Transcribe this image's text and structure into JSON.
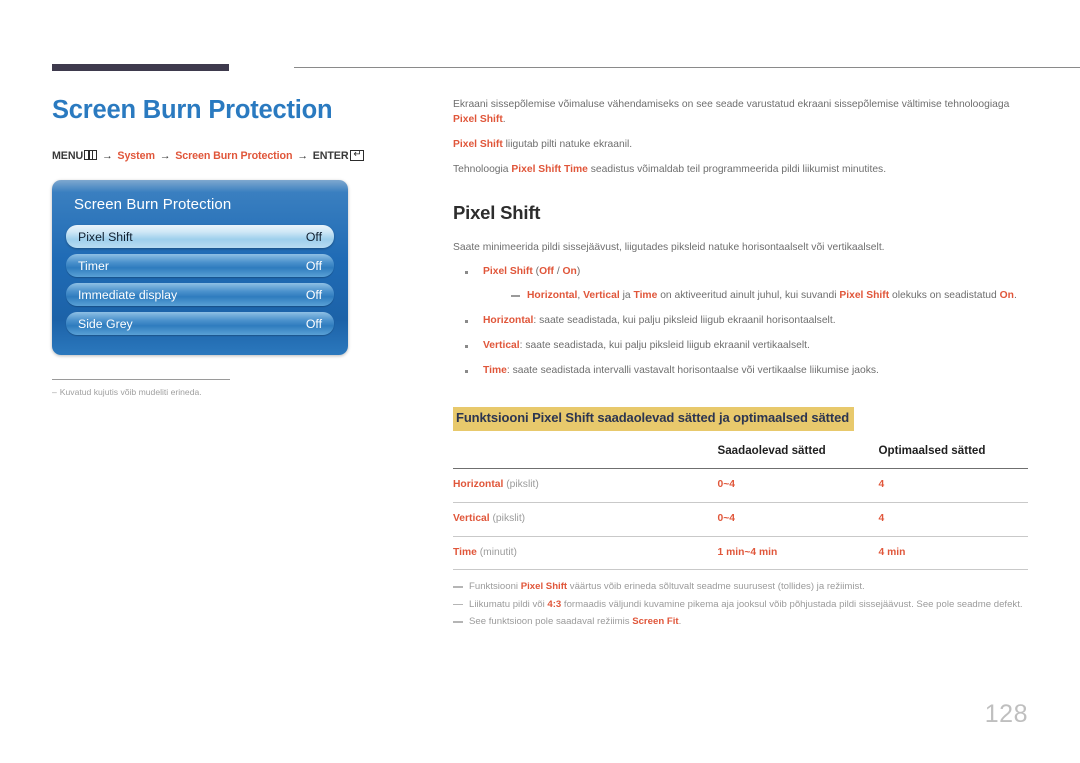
{
  "page_title": "Screen Burn Protection",
  "breadcrumb": {
    "menu_label": "MENU",
    "arrow": "→",
    "item1": "System",
    "item2": "Screen Burn Protection",
    "enter_label": "ENTER",
    "enter_glyph": "↵"
  },
  "osd": {
    "title": "Screen Burn Protection",
    "rows": [
      {
        "label": "Pixel Shift",
        "value": "Off",
        "selected": true
      },
      {
        "label": "Timer",
        "value": "Off",
        "selected": false
      },
      {
        "label": "Immediate display",
        "value": "Off",
        "selected": false
      },
      {
        "label": "Side Grey",
        "value": "Off",
        "selected": false
      }
    ]
  },
  "left_note": "Kuvatud kujutis võib mudeliti erineda.",
  "intro": {
    "p1_a": "Ekraani sissepõlemise võimaluse vähendamiseks on see seade varustatud ekraani sissepõlemise vältimise tehnoloogiaga ",
    "p1_accent": "Pixel Shift",
    "p1_b": ".",
    "p2_accent": "Pixel Shift",
    "p2_b": " liigutab pilti natuke ekraanil.",
    "p3_a": "Tehnoloogia ",
    "p3_accent": "Pixel Shift Time",
    "p3_b": " seadistus võimaldab teil programmeerida pildi liikumist minutites."
  },
  "section": {
    "title": "Pixel Shift",
    "lead": "Saate minimeerida pildi sissejäävust, liigutades piksleid natuke horisontaalselt või vertikaalselt."
  },
  "bullets": {
    "b1_accent": "Pixel Shift",
    "b1_text": " (",
    "b1_off": "Off",
    "b1_sep": " / ",
    "b1_on": "On",
    "b1_end": ")",
    "subnote_a1": "Horizontal",
    "subnote_t1": ", ",
    "subnote_a2": "Vertical",
    "subnote_t2": " ja ",
    "subnote_a3": "Time",
    "subnote_t3": " on aktiveeritud ainult juhul, kui suvandi ",
    "subnote_a4": "Pixel Shift",
    "subnote_t4": " olekuks on seadistatud ",
    "subnote_a5": "On",
    "subnote_t5": ".",
    "b2_accent": "Horizontal",
    "b2_text": ": saate seadistada, kui palju piksleid liigub ekraanil horisontaalselt.",
    "b3_accent": "Vertical",
    "b3_text": ": saate seadistada, kui palju piksleid liigub ekraanil vertikaalselt.",
    "b4_accent": "Time",
    "b4_text": ": saate seadistada intervalli vastavalt horisontaalse või vertikaalse liikumise jaoks."
  },
  "table": {
    "highlight_title": "Funktsiooni Pixel Shift saadaolevad sätted ja optimaalsed sätted",
    "headers": [
      "",
      "Saadaolevad sätted",
      "Optimaalsed sätted"
    ],
    "rows": [
      {
        "name": "Horizontal",
        "unit": " (pikslit)",
        "available": "0~4",
        "optimal": "4"
      },
      {
        "name": "Vertical",
        "unit": " (pikslit)",
        "available": "0~4",
        "optimal": "4"
      },
      {
        "name": "Time",
        "unit": " (minutit)",
        "available": "1 min~4 min",
        "optimal": "4 min"
      }
    ]
  },
  "footnotes": {
    "f1_a": "Funktsiooni ",
    "f1_accent": "Pixel Shift",
    "f1_b": " väärtus võib erineda sõltuvalt seadme suurusest (tollides) ja režiimist.",
    "f2_a": "Liikumatu pildi või ",
    "f2_accent": "4:3",
    "f2_b": " formaadis väljundi kuvamine pikema aja jooksul võib põhjustada pildi sissejäävust. See pole seadme defekt.",
    "f3_a": "See funktsioon pole saadaval režiimis ",
    "f3_accent": "Screen Fit",
    "f3_b": "."
  },
  "page_number": "128",
  "colors": {
    "heading_blue": "#2a7ac0",
    "accent_orange": "#e0563a",
    "highlight_yellow": "#e8c96c",
    "rule_dark": "#3e3a4d",
    "osd_blue": "#1f6bb5"
  }
}
